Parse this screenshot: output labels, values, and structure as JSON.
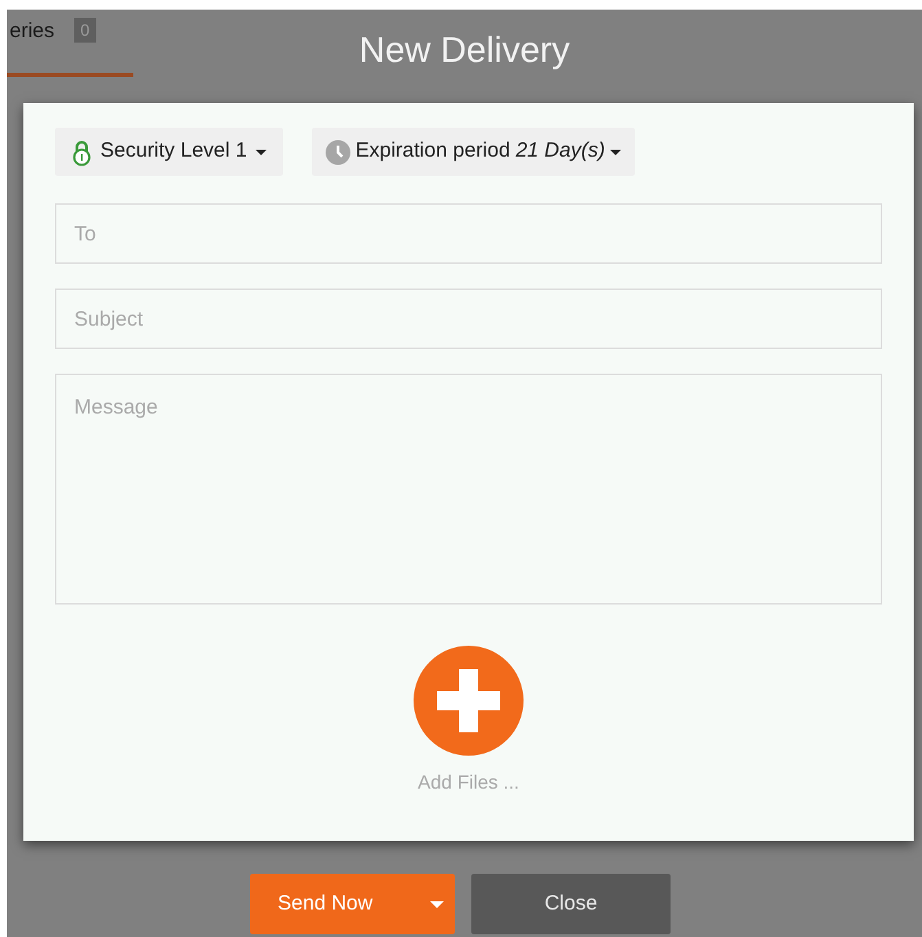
{
  "background_tab": {
    "label": "eries",
    "badge": "0",
    "selected": true
  },
  "dialog": {
    "title": "New Delivery",
    "security_dropdown": {
      "label": "Security Level 1"
    },
    "expiration_dropdown": {
      "label": "Expiration period",
      "value": "21 Day(s)"
    },
    "to_field": {
      "placeholder": "To"
    },
    "subject_field": {
      "placeholder": "Subject"
    },
    "message_field": {
      "placeholder": "Message"
    },
    "add_files": {
      "label": "Add Files ..."
    },
    "buttons": [
      {
        "label": "Send Now",
        "kind": "primary-split"
      },
      {
        "label": "Close",
        "kind": "secondary"
      }
    ]
  }
}
